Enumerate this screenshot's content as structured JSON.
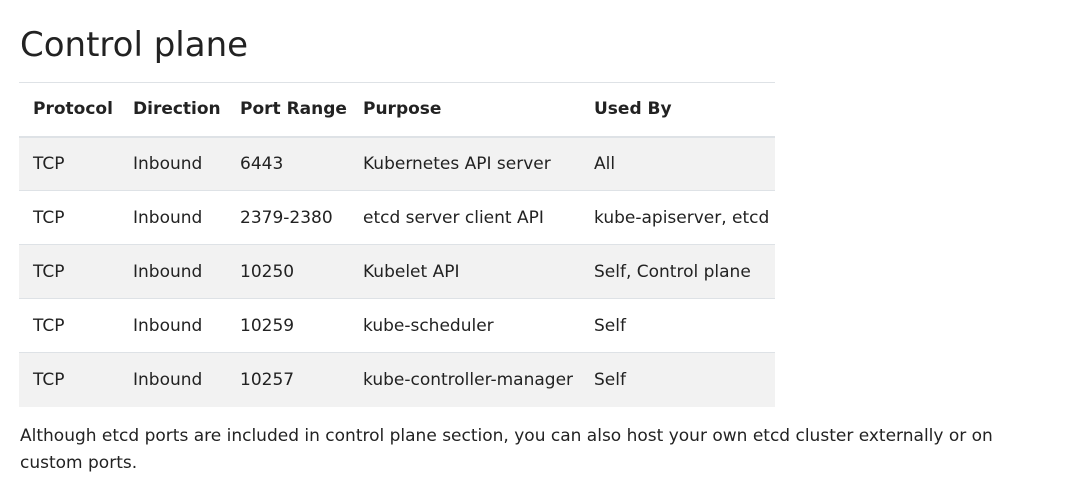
{
  "heading": "Control plane",
  "table": {
    "headers": [
      "Protocol",
      "Direction",
      "Port Range",
      "Purpose",
      "Used By"
    ],
    "rows": [
      [
        "TCP",
        "Inbound",
        "6443",
        "Kubernetes API server",
        "All"
      ],
      [
        "TCP",
        "Inbound",
        "2379-2380",
        "etcd server client API",
        "kube-apiserver, etcd"
      ],
      [
        "TCP",
        "Inbound",
        "10250",
        "Kubelet API",
        "Self, Control plane"
      ],
      [
        "TCP",
        "Inbound",
        "10259",
        "kube-scheduler",
        "Self"
      ],
      [
        "TCP",
        "Inbound",
        "10257",
        "kube-controller-manager",
        "Self"
      ]
    ]
  },
  "note": "Although etcd ports are included in control plane section, you can also host your own etcd cluster externally or on custom ports."
}
